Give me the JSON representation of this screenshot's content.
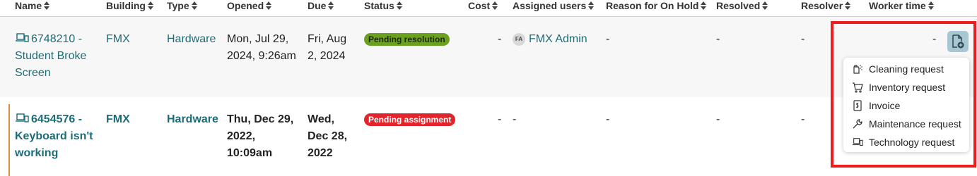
{
  "columns": [
    {
      "key": "name",
      "label": "Name"
    },
    {
      "key": "building",
      "label": "Building"
    },
    {
      "key": "type",
      "label": "Type"
    },
    {
      "key": "opened",
      "label": "Opened"
    },
    {
      "key": "due",
      "label": "Due"
    },
    {
      "key": "status",
      "label": "Status"
    },
    {
      "key": "cost",
      "label": "Cost"
    },
    {
      "key": "assigned_users",
      "label": "Assigned users"
    },
    {
      "key": "reason_on_hold",
      "label": "Reason for On Hold"
    },
    {
      "key": "resolved",
      "label": "Resolved"
    },
    {
      "key": "resolver",
      "label": "Resolver"
    },
    {
      "key": "worker_time",
      "label": "Worker time"
    }
  ],
  "rows": [
    {
      "name_line1": "6748210 -",
      "name_line2": "Student Broke",
      "name_line3": "Screen",
      "building": "FMX",
      "type": "Hardware",
      "opened_line1": "Mon, Jul 29,",
      "opened_line2": "2024, 9:26am",
      "due_line1": "Fri, Aug",
      "due_line2": "2, 2024",
      "status": "Pending resolution",
      "cost": "-",
      "assigned_initials": "FA",
      "assigned_user": "FMX Admin",
      "reason_on_hold": "-",
      "resolved": "-",
      "resolver": "-",
      "worker_time": "-"
    },
    {
      "name_line1": "6454576 -",
      "name_line2": "Keyboard isn't",
      "name_line3": "working",
      "building": "FMX",
      "type": "Hardware",
      "opened_line1": "Thu, Dec 29,",
      "opened_line2": "2022,",
      "opened_line3": "10:09am",
      "due_line1": "Wed,",
      "due_line2": "Dec 28,",
      "due_line3": "2022",
      "status": "Pending assignment",
      "cost": "-",
      "assigned_user": "-",
      "reason_on_hold": "-",
      "resolved": "-",
      "resolver": "-"
    }
  ],
  "request_menu": {
    "items": [
      {
        "label": "Cleaning request",
        "icon": "spray-icon"
      },
      {
        "label": "Inventory request",
        "icon": "cart-icon"
      },
      {
        "label": "Invoice",
        "icon": "invoice-icon"
      },
      {
        "label": "Maintenance request",
        "icon": "wrench-icon"
      },
      {
        "label": "Technology request",
        "icon": "laptop-icon"
      }
    ]
  },
  "colors": {
    "link": "#1a6d79",
    "status_resolution": "#6aa11f",
    "status_assignment": "#e5232b",
    "highlight": "#ee1c1c",
    "add_button": "#a7c7d3"
  }
}
